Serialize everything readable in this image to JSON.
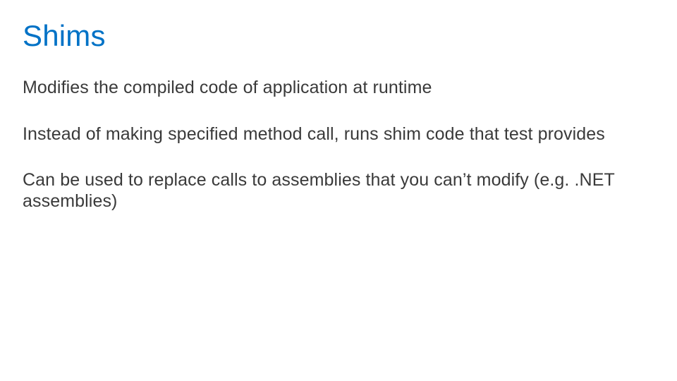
{
  "slide": {
    "title": "Shims",
    "paragraphs": [
      "Modifies the compiled code of application at runtime",
      "Instead of making specified method call, runs shim code that test provides",
      "Can be used to replace calls to assemblies that you can’t modify (e.g. .NET assemblies)"
    ]
  },
  "colors": {
    "title": "#0072c6",
    "body": "#3a3a3a",
    "background": "#ffffff"
  }
}
